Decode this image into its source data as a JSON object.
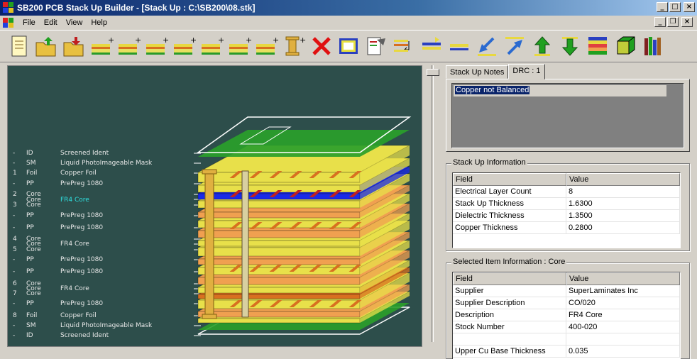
{
  "window": {
    "title": "SB200 PCB Stack Up Builder - [Stack Up : C:\\SB200\\08.stk]",
    "btn_min": "_",
    "btn_max": "□",
    "btn_close": "×"
  },
  "menu": [
    "File",
    "Edit",
    "View",
    "Help"
  ],
  "mdi": {
    "btn_min": "_",
    "btn_restore": "❐",
    "btn_close": "×"
  },
  "toolbar_icons": [
    "new-stackup-icon",
    "open-stackup-icon",
    "open-recent-icon",
    "add-layer-icon",
    "add-layer-icon",
    "add-layer-icon",
    "add-layer-icon",
    "add-layer-icon",
    "add-layer-icon",
    "add-layer-icon",
    "add-via-icon",
    "delete-icon",
    "properties-icon",
    "report-icon",
    "swap-layers-icon",
    "insert-layers-icon",
    "remove-layers-icon",
    "move-down-left-icon",
    "move-up-right-icon",
    "move-up-icon",
    "move-down-icon",
    "layer-colors-icon",
    "3d-view-icon",
    "library-icon"
  ],
  "layers": [
    {
      "num": "-",
      "type": "ID",
      "material": "Screened Ident"
    },
    {
      "num": "-",
      "type": "SM",
      "material": "Liquid PhotoImageable Mask"
    },
    {
      "num": "1",
      "type": "Foil",
      "material": "Copper Foil"
    },
    {
      "num": "-",
      "type": "PP",
      "material": "PrePreg 1080"
    },
    {
      "num": "2",
      "type": "Core",
      "material": ""
    },
    {
      "num": "",
      "type": "Core",
      "material": "FR4 Core"
    },
    {
      "num": "3",
      "type": "Core",
      "material": ""
    },
    {
      "num": "-",
      "type": "PP",
      "material": "PrePreg 1080"
    },
    {
      "num": "-",
      "type": "PP",
      "material": "PrePreg 1080"
    },
    {
      "num": "4",
      "type": "Core",
      "material": ""
    },
    {
      "num": "",
      "type": "Core",
      "material": "FR4 Core"
    },
    {
      "num": "5",
      "type": "Core",
      "material": ""
    },
    {
      "num": "-",
      "type": "PP",
      "material": "PrePreg 1080"
    },
    {
      "num": "-",
      "type": "PP",
      "material": "PrePreg 1080"
    },
    {
      "num": "6",
      "type": "Core",
      "material": ""
    },
    {
      "num": "",
      "type": "Core",
      "material": "FR4 Core"
    },
    {
      "num": "7",
      "type": "Core",
      "material": ""
    },
    {
      "num": "-",
      "type": "PP",
      "material": "PrePreg 1080"
    },
    {
      "num": "8",
      "type": "Foil",
      "material": "Copper Foil"
    },
    {
      "num": "-",
      "type": "SM",
      "material": "Liquid PhotoImageable Mask"
    },
    {
      "num": "-",
      "type": "ID",
      "material": "Screened Ident"
    }
  ],
  "tabs": {
    "notes": "Stack Up Notes",
    "drc": "DRC : 1"
  },
  "drc_message": "Copper not Balanced",
  "stackup_info": {
    "title": "Stack Up Information",
    "col_field": "Field",
    "col_value": "Value",
    "rows": [
      {
        "field": "Electrical Layer Count",
        "value": "8"
      },
      {
        "field": "Stack Up Thickness",
        "value": "1.6300"
      },
      {
        "field": "Dielectric Thickness",
        "value": "1.3500"
      },
      {
        "field": "Copper Thickness",
        "value": "0.2800"
      }
    ]
  },
  "selected_info": {
    "title": "Selected Item Information : Core",
    "col_field": "Field",
    "col_value": "Value",
    "rows": [
      {
        "field": "Supplier",
        "value": "SuperLaminates Inc"
      },
      {
        "field": "Supplier Description",
        "value": "CO/020"
      },
      {
        "field": "Description",
        "value": "FR4 Core"
      },
      {
        "field": "Stock Number",
        "value": "400-020"
      },
      {
        "field": "",
        "value": ""
      },
      {
        "field": "Upper Cu Base Thickness",
        "value": "0.035"
      }
    ]
  },
  "colors": {
    "canvas_bg": "#2d4e4b",
    "core": "#e8e04a",
    "prepreg": "#f0a050",
    "copper": "#d87020",
    "mask": "#2aa02a",
    "selected_core": "#1a2ae8"
  }
}
